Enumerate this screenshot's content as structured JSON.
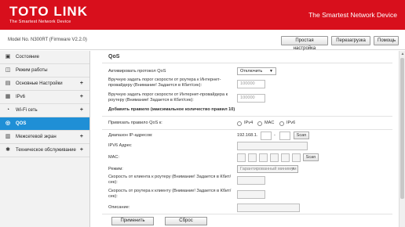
{
  "header": {
    "logo_text": "TOTO LINK",
    "logo_tagline": "The Smartest Network Device",
    "slogan": "The Smartest Network Device",
    "bg_color": "#d80f1c"
  },
  "toolbar": {
    "model": "Model No. N300RT (Firmware V2.2.0)",
    "easy_setup": "Простая настройка",
    "reboot": "Перезагрузка",
    "help": "Помощь"
  },
  "sidebar": {
    "items": [
      {
        "label": "Состояние",
        "icon": "monitor-icon",
        "glyph": "▣",
        "plus": ""
      },
      {
        "label": "Режим работы",
        "icon": "mode-icon",
        "glyph": "◫",
        "plus": ""
      },
      {
        "label": "Основные Настройки",
        "icon": "settings-icon",
        "glyph": "▤",
        "plus": "+"
      },
      {
        "label": "IPv6",
        "icon": "ipv6-icon",
        "glyph": "▦",
        "plus": "+"
      },
      {
        "label": "Wi-Fi сеть",
        "icon": "wifi-icon",
        "glyph": "◔",
        "plus": "+"
      },
      {
        "label": "QOS",
        "icon": "qos-icon",
        "glyph": "◎",
        "plus": ""
      },
      {
        "label": "Межсетевой экран",
        "icon": "firewall-icon",
        "glyph": "▥",
        "plus": "+"
      },
      {
        "label": "Техническое обслуживание",
        "icon": "maintenance-icon",
        "glyph": "✱",
        "plus": "+"
      }
    ],
    "active_color": "#1f8fd6"
  },
  "qos": {
    "title": "QoS",
    "enable_label": "Активировать протокол QoS",
    "enable_value": "Отключить",
    "upload_label": "Вручную задать порог скорости от роутера к Интернет-провайдеру (Внимание! Задается в Кбит/сек):",
    "upload_placeholder": "100000",
    "download_label": "Вручную задать порог скорости от Интернет-провайдера к роутеру (Внимание! Задается в Кбит/сек):",
    "download_placeholder": "100000",
    "add_rule_heading": "Добавить правило (максимальное количество правил 10)",
    "bind_label": "Привязать правило QoS к:",
    "radio_ipv4": "IPv4",
    "radio_mac": "MAC",
    "radio_ipv6": "IPv6",
    "ip_range_label": "Диапазон IP-адресов:",
    "ip_prefix": "192.168.1.",
    "ip_dash": "-",
    "scan": "Scan",
    "ipv6_label": "IPV6 Адрес",
    "mac_label": "MAC:",
    "mode_label": "Режим:",
    "mode_value": "Гарантированный минимум",
    "client_router_label": "Скорость от клиента к роутеру (Внимание! Задается в Кбит/сек):",
    "router_client_label": "Скорость от роутера к клиенту (Внимание! Задается в Кбит/сек):",
    "description_label": "Описание:",
    "apply": "Применить",
    "reset": "Сброс"
  }
}
